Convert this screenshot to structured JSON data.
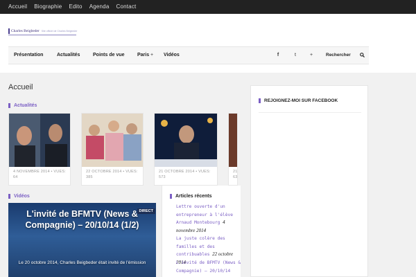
{
  "topbar": {
    "items": [
      "Accueil",
      "Biographie",
      "Edito",
      "Agenda",
      "Contact"
    ]
  },
  "logo": {
    "name": "Charles Beigbeder",
    "tagline": "Site officiel de Charles Beigbeder"
  },
  "mainnav": {
    "items": [
      "Présentation",
      "Actualités",
      "Points de vue",
      "Paris",
      "Vidéos"
    ],
    "paris_submenu_indicator": "+",
    "facebook_icon": "f",
    "twitter_icon": "t",
    "plus_icon": "+",
    "search_label": "Rechercher"
  },
  "breadcrumb": "Accueil",
  "actualites": {
    "heading": "Actualités",
    "cards": [
      {
        "date": "4 NOVEMBRE 2014",
        "views": "VUES: 64"
      },
      {
        "date": "22 OCTOBRE 2014",
        "views": "VUES: 385"
      },
      {
        "date": "21 OCTOBRE 2014",
        "views": "VUES: 573"
      },
      {
        "date": "21",
        "views": "63"
      }
    ]
  },
  "videos": {
    "heading": "Vidéos",
    "title": "L'invité de BFMTV (News & Compagnie) – 20/10/14 (1/2)",
    "desc": "Le 20 octobre 2014, Charles Beigbeder était invité de l'émission",
    "direct_label": "DIRECT"
  },
  "recent": {
    "heading": "Articles récents",
    "posts": [
      {
        "title": "Lettre ouverte d'un entrepreneur à l'élève Arnaud Montebourg",
        "date": "4 novembre 2014"
      },
      {
        "title": "La juste colère des familles et des contribuables",
        "date": "22 octobre 2014"
      },
      {
        "title": "L'invité de BFMTV (News & Compagnie) – 20/10/14",
        "date": ""
      }
    ]
  },
  "facebook": {
    "heading": "REJOIGNEZ-MOI SUR FACEBOOK"
  },
  "colors": {
    "accent": "#7b5fc4",
    "topbar": "#222222",
    "logo": "#3b2d7a"
  }
}
